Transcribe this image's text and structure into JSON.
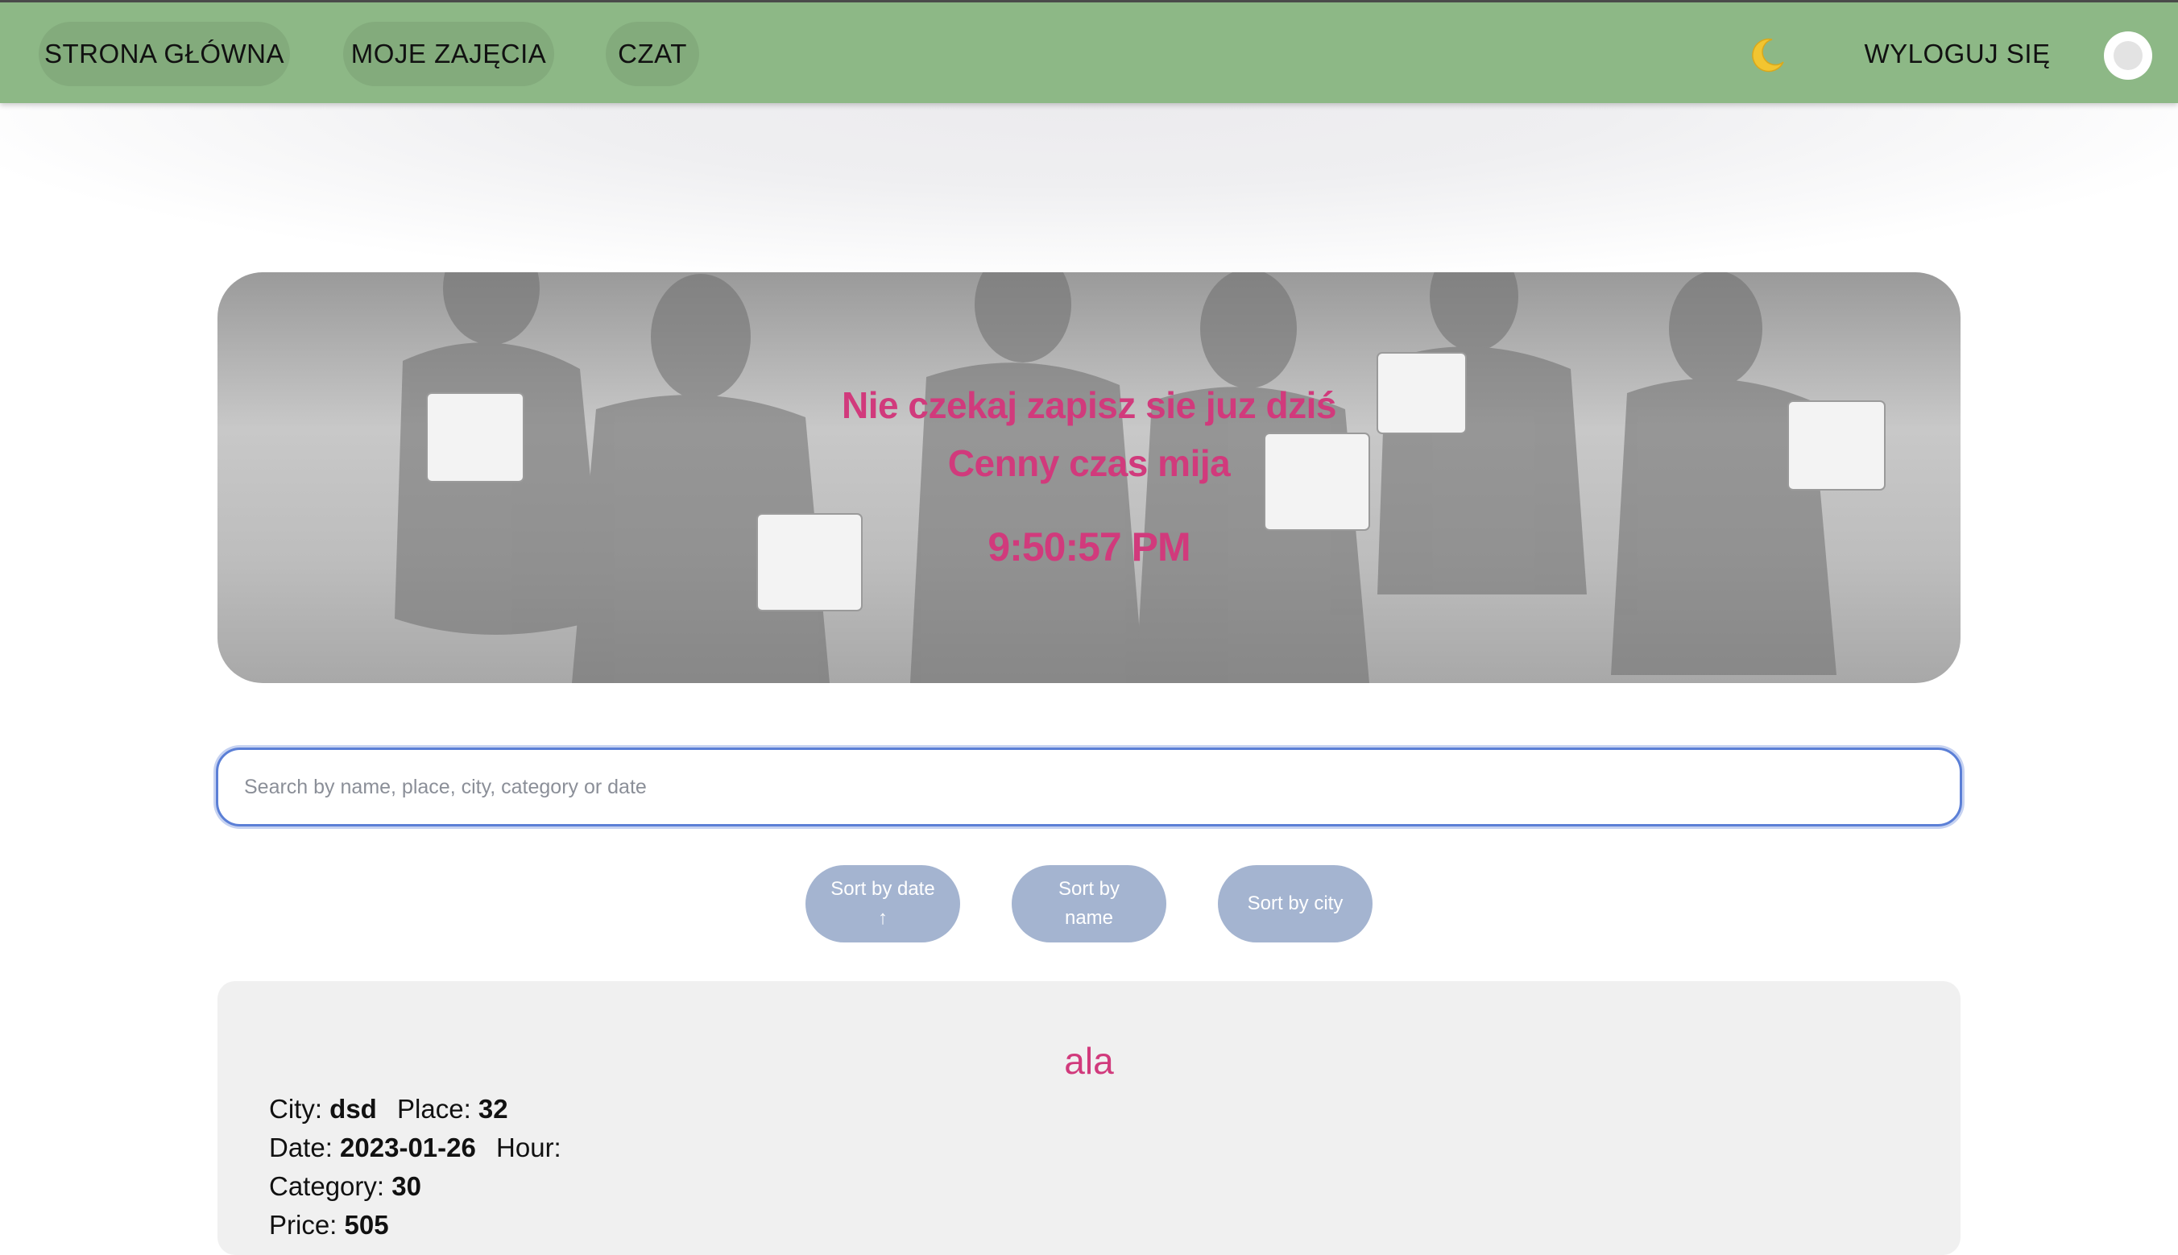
{
  "nav": {
    "items": [
      {
        "label": "STRONA GŁÓWNA"
      },
      {
        "label": "MOJE ZAJĘCIA"
      },
      {
        "label": "CZAT"
      }
    ],
    "theme_icon": "moon-icon",
    "logout_label": "WYLOGUJ SIĘ",
    "colors": {
      "bar": "#8db886"
    }
  },
  "hero": {
    "line1": "Nie czekaj zapisz sie juz dziś",
    "line2": "Cenny czas mija",
    "clock": "9:50:57 PM",
    "text_color": "#d13a7c"
  },
  "search": {
    "placeholder": "Search by name, place, city, category or date",
    "value": ""
  },
  "sort": {
    "date_label": "Sort by date ↑",
    "name_label": "Sort by name",
    "city_label": "Sort by city"
  },
  "card": {
    "title": "ala",
    "city_label": "City:",
    "city": "dsd",
    "place_label": "Place:",
    "place": "32",
    "date_label": "Date:",
    "date": "2023-01-26",
    "hour_label": "Hour:",
    "hour": "",
    "category_label": "Category:",
    "category": "30",
    "price_label": "Price:",
    "price": "505"
  }
}
